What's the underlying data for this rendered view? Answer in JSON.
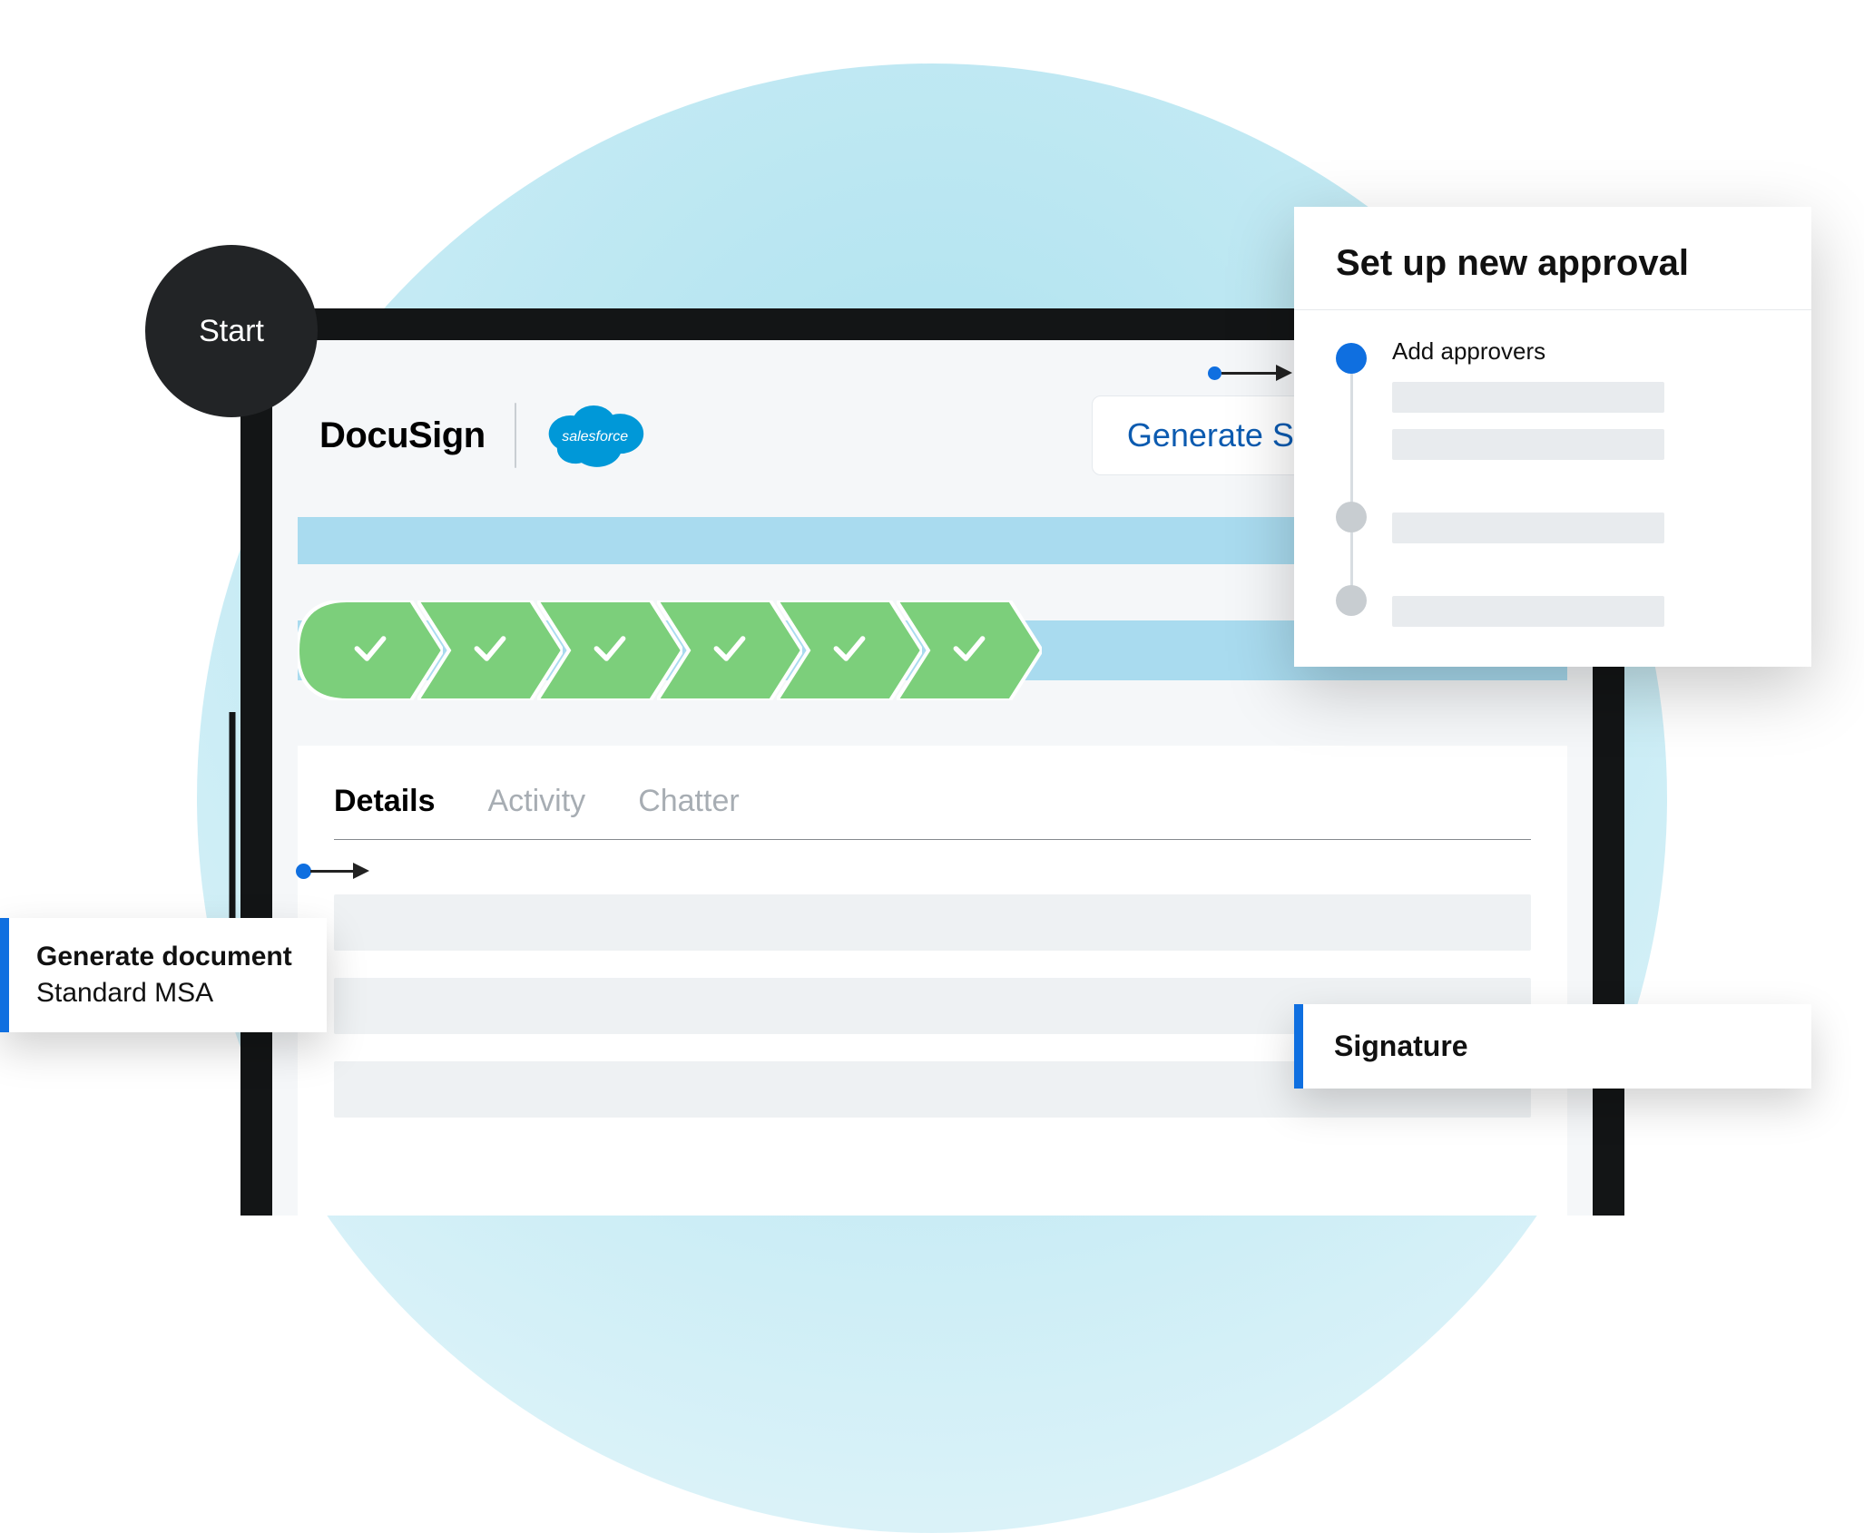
{
  "start_label": "Start",
  "brand": {
    "docusign": "DocuSign",
    "salesforce": "salesforce"
  },
  "action_button": "Generate Sales Order",
  "progress": {
    "completed_steps": 6
  },
  "tabs": [
    {
      "label": "Details",
      "active": true
    },
    {
      "label": "Activity",
      "active": false
    },
    {
      "label": "Chatter",
      "active": false
    }
  ],
  "callouts": {
    "generate_document": {
      "heading": "Generate document",
      "subtext": "Standard MSA"
    },
    "signature": {
      "heading": "Signature"
    }
  },
  "approval": {
    "title": "Set up new approval",
    "step_label": "Add approvers"
  },
  "colors": {
    "accent_blue": "#0f6fe0",
    "progress_green": "#7ccf7b",
    "pale_blue": "#a9dbef"
  }
}
